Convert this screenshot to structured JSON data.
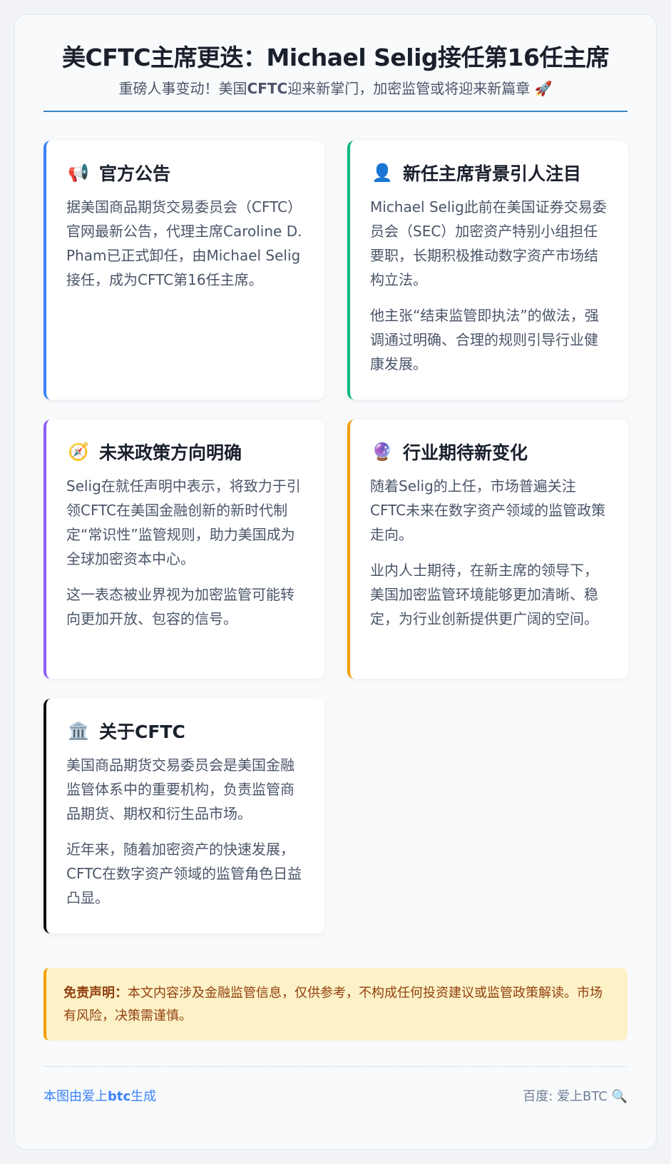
{
  "header": {
    "title": "美CFTC主席更迭：Michael Selig接任第16任主席",
    "subtitle_pre": "重磅人事变动！美国",
    "subtitle_bold": "CFTC",
    "subtitle_post": "迎来新掌门，加密监管或将迎来新篇章 🚀"
  },
  "cards": [
    {
      "icon": "megaphone-icon",
      "emoji": "📢",
      "title": "官方公告",
      "accent": "#3b82f6",
      "paragraphs": [
        "据美国商品期货交易委员会（CFTC）官网最新公告，代理主席Caroline D. Pham已正式卸任，由Michael Selig接任，成为CFTC第16任主席。"
      ]
    },
    {
      "icon": "person-icon",
      "emoji": "👤",
      "title": "新任主席背景引人注目",
      "accent": "#10b981",
      "paragraphs": [
        "Michael Selig此前在美国证券交易委员会（SEC）加密资产特别小组担任要职，长期积极推动数字资产市场结构立法。",
        "他主张“结束监管即执法”的做法，强调通过明确、合理的规则引导行业健康发展。"
      ]
    },
    {
      "icon": "compass-icon",
      "emoji": "🧭",
      "title": "未来政策方向明确",
      "accent": "#8b5cf6",
      "paragraphs": [
        "Selig在就任声明中表示，将致力于引领CFTC在美国金融创新的新时代制定“常识性”监管规则，助力美国成为全球加密资本中心。",
        "这一表态被业界视为加密监管可能转向更加开放、包容的信号。"
      ]
    },
    {
      "icon": "crystal-ball-icon",
      "emoji": "🔮",
      "title": "行业期待新变化",
      "accent": "#f59e0b",
      "paragraphs": [
        "随着Selig的上任，市场普遍关注CFTC未来在数字资产领域的监管政策走向。",
        "业内人士期待，在新主席的领导下，美国加密监管环境能够更加清晰、稳定，为行业创新提供更广阔的空间。"
      ]
    },
    {
      "icon": "bank-building-icon",
      "emoji": "🏛️",
      "title": "关于CFTC",
      "accent": "#111111",
      "paragraphs": [
        "美国商品期货交易委员会是美国金融监管体系中的重要机构，负责监管商品期货、期权和衍生品市场。",
        "近年来，随着加密资产的快速发展，CFTC在数字资产领域的监管角色日益凸显。"
      ]
    }
  ],
  "disclaimer": {
    "label": "免责声明：",
    "text": "本文内容涉及金融监管信息，仅供参考，不构成任何投资建议或监管政策解读。市场有风险，决策需谨慎。"
  },
  "footer": {
    "left_pre": "本图由爱上",
    "left_bold": "btc",
    "left_post": "生成",
    "right": "百度: 爱上BTC 🔍"
  }
}
